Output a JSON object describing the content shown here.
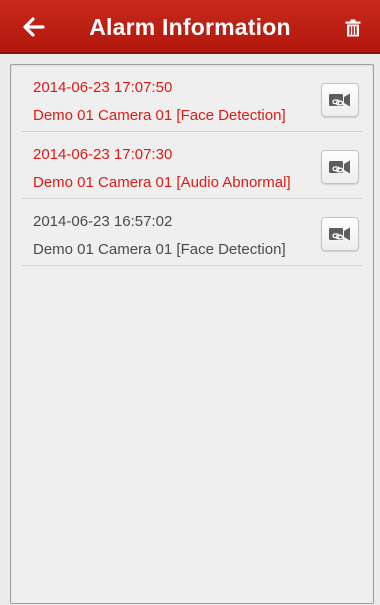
{
  "header": {
    "title": "Alarm Information",
    "back_icon": "back-arrow-icon",
    "delete_icon": "trash-icon",
    "background_color": "#c0231a"
  },
  "alarms": [
    {
      "time": "2014-06-23 17:07:50",
      "description": "Demo 01 Camera 01 [Face Detection]",
      "status": "unread",
      "color": "#e01b16",
      "action_icon": "camera-link-icon"
    },
    {
      "time": "2014-06-23 17:07:30",
      "description": "Demo 01 Camera 01 [Audio Abnormal]",
      "status": "unread",
      "color": "#e01b16",
      "action_icon": "camera-link-icon"
    },
    {
      "time": "2014-06-23 16:57:02",
      "description": "Demo 01 Camera 01 [Face Detection]",
      "status": "read",
      "color": "#4a4a4a",
      "action_icon": "camera-link-icon"
    }
  ]
}
